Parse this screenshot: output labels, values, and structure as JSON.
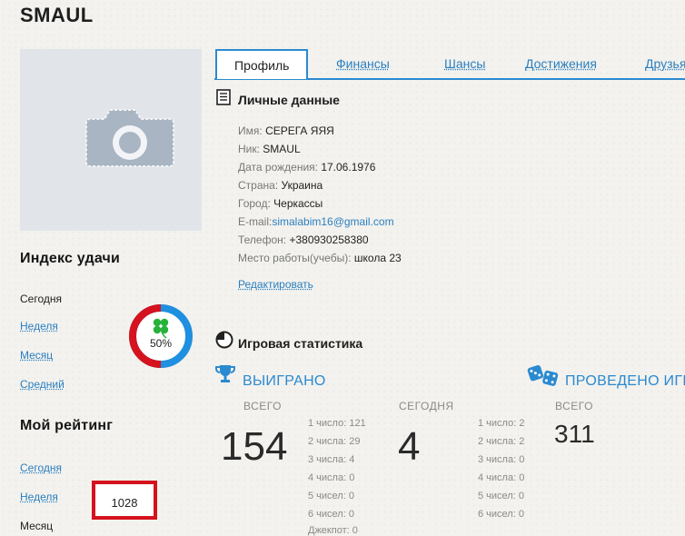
{
  "username": "SMAUL",
  "tabs": [
    "Профиль",
    "Финансы",
    "Шансы",
    "Достижения",
    "Друзья"
  ],
  "luck": {
    "title": "Индекс удачи",
    "periods": [
      "Сегодня",
      "Неделя",
      "Месяц",
      "Средний"
    ],
    "percent_label": "50%",
    "percent": 50
  },
  "rating": {
    "title": "Мой рейтинг",
    "periods": [
      "Сегодня",
      "Неделя",
      "Месяц"
    ],
    "value": "1028"
  },
  "personal": {
    "title": "Личные данные",
    "fields": [
      {
        "label": "Имя:",
        "value": "СЕРЕГА ЯЯЯ"
      },
      {
        "label": "Ник:",
        "value": "SMAUL"
      },
      {
        "label": "Дата рождения:",
        "value": "17.06.1976"
      },
      {
        "label": "Страна:",
        "value": "Украина"
      },
      {
        "label": "Город:",
        "value": "Черкассы"
      },
      {
        "label": "E-mail:",
        "value": "simalabim16@gmail.com"
      },
      {
        "label": "Телефон:",
        "value": "+380930258380"
      },
      {
        "label": "Место работы(учебы):",
        "value": "школа 23"
      }
    ],
    "edit_label": "Редактировать"
  },
  "game_stats": {
    "title": "Игровая статистика",
    "won": {
      "title": "ВЫИГРАНО",
      "total_label": "ВСЕГО",
      "total": "154",
      "today_label": "СЕГОДНЯ",
      "today": "4",
      "total_breakdown": [
        "1 число: 121",
        "2 числа: 29",
        "3 числа: 4",
        "4 числа: 0",
        "5 чисел: 0",
        "6 чисел: 0",
        "Джекпот: 0"
      ],
      "today_breakdown": [
        "1 число: 2",
        "2 числа: 2",
        "3 числа: 0",
        "4 числа: 0",
        "5 чисел: 0",
        "6 чисел: 0"
      ]
    },
    "played": {
      "title": "ПРОВЕДЕНО ИГР",
      "total_label": "ВСЕГО",
      "total": "311"
    }
  },
  "colors": {
    "accent": "#2b8ad0",
    "ring_red": "#d5121e",
    "ring_blue": "#1f8fe0",
    "clover": "#27b23a",
    "highlight_box": "#d5121e"
  }
}
